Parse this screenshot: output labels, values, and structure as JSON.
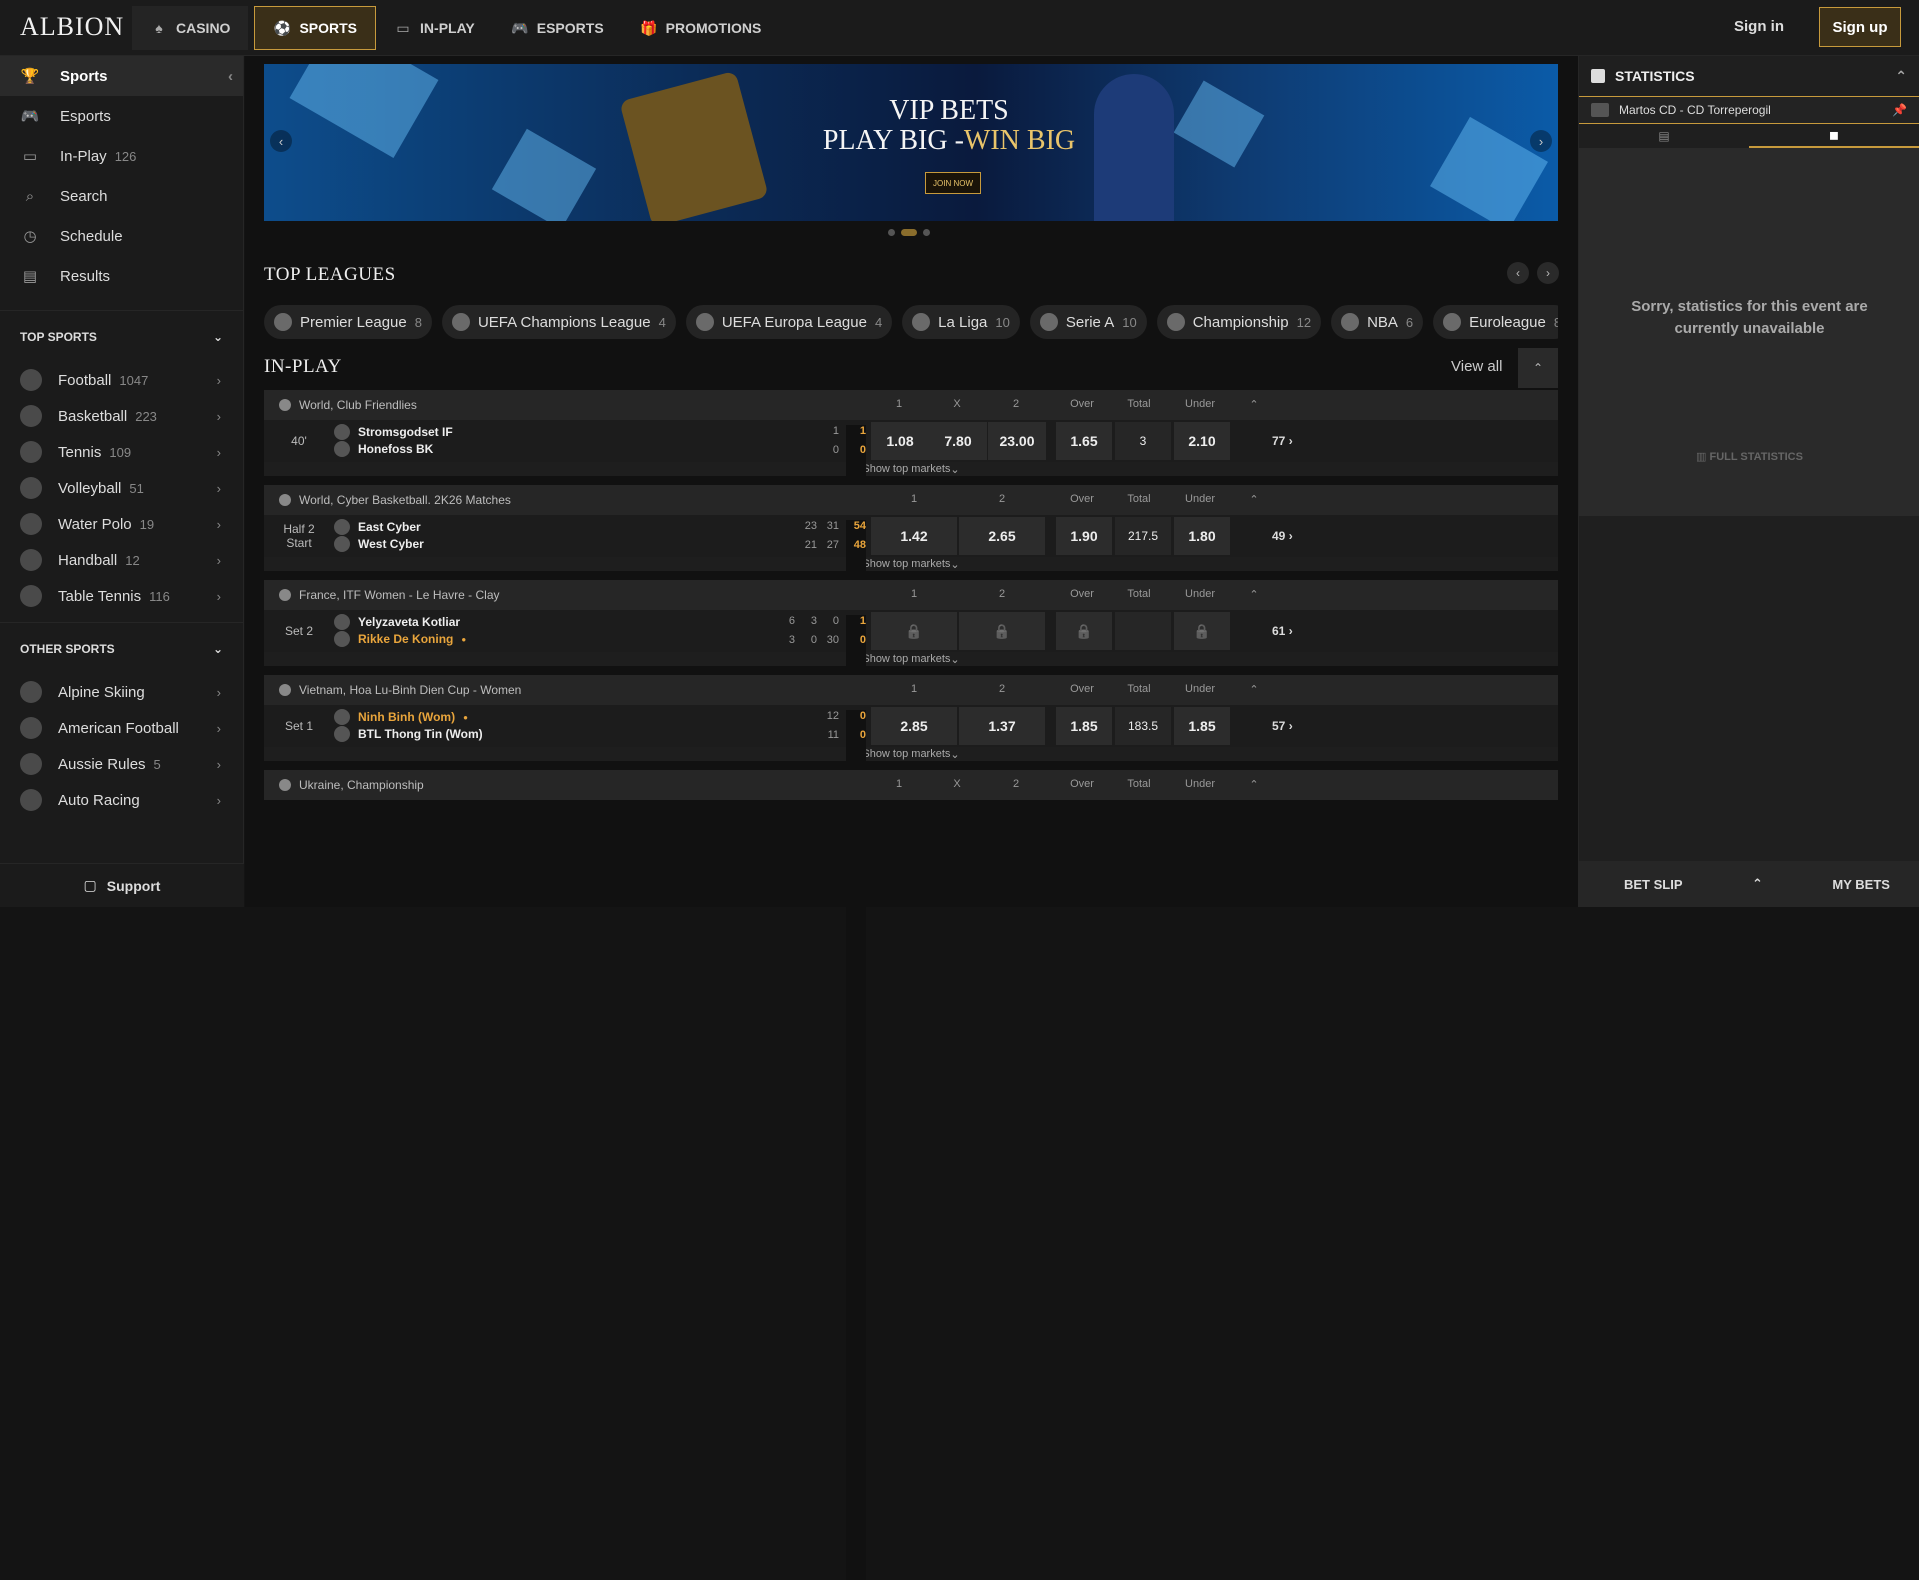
{
  "header": {
    "logo": "ALBION",
    "nav": [
      {
        "label": "CASINO",
        "icon": "spade-icon"
      },
      {
        "label": "SPORTS",
        "icon": "ball-icon",
        "active": true
      },
      {
        "label": "IN-PLAY",
        "icon": "live-icon"
      },
      {
        "label": "ESPORTS",
        "icon": "gamepad-icon"
      },
      {
        "label": "PROMOTIONS",
        "icon": "gift-icon"
      }
    ],
    "signin": "Sign in",
    "signup": "Sign up"
  },
  "sidebar": {
    "items": [
      {
        "label": "Sports",
        "icon": "trophy-icon",
        "active": true
      },
      {
        "label": "Esports",
        "icon": "gamepad-icon"
      },
      {
        "label": "In-Play",
        "count": "126",
        "icon": "live-icon"
      },
      {
        "label": "Search",
        "icon": "search-icon"
      },
      {
        "label": "Schedule",
        "icon": "clock-icon"
      },
      {
        "label": "Results",
        "icon": "clipboard-icon"
      }
    ],
    "top_sports_title": "TOP SPORTS",
    "top_sports": [
      {
        "label": "Football",
        "count": "1047"
      },
      {
        "label": "Basketball",
        "count": "223"
      },
      {
        "label": "Tennis",
        "count": "109"
      },
      {
        "label": "Volleyball",
        "count": "51"
      },
      {
        "label": "Water Polo",
        "count": "19"
      },
      {
        "label": "Handball",
        "count": "12"
      },
      {
        "label": "Table Tennis",
        "count": "116"
      }
    ],
    "other_sports_title": "OTHER SPORTS",
    "other_sports": [
      {
        "label": "Alpine Skiing",
        "count": ""
      },
      {
        "label": "American Football",
        "count": ""
      },
      {
        "label": "Aussie Rules",
        "count": "5"
      },
      {
        "label": "Auto Racing",
        "count": ""
      }
    ],
    "support": "Support"
  },
  "banner": {
    "line1": "VIP BETS",
    "line2a": "PLAY BIG -",
    "line2b": "WIN BIG",
    "cta": "JOIN NOW"
  },
  "top_leagues": {
    "title": "TOP LEAGUES",
    "items": [
      {
        "label": "Premier League",
        "count": "8"
      },
      {
        "label": "UEFA Champions League",
        "count": "4"
      },
      {
        "label": "UEFA Europa League",
        "count": "4"
      },
      {
        "label": "La Liga",
        "count": "10"
      },
      {
        "label": "Serie A",
        "count": "10"
      },
      {
        "label": "Championship",
        "count": "12"
      },
      {
        "label": "NBA",
        "count": "6"
      },
      {
        "label": "Euroleague",
        "count": "8"
      }
    ]
  },
  "inplay": {
    "title": "IN-PLAY",
    "view_all": "View all",
    "show_top": "Show top markets",
    "events": [
      {
        "league": "World, Club Friendlies",
        "cols": [
          "1",
          "X",
          "2",
          "Over",
          "Total",
          "Under"
        ],
        "time1": "40'",
        "time2": "",
        "home": "Stromsgodset IF",
        "away": "Honefoss BK",
        "hs": [
          "",
          "1"
        ],
        "as": [
          "",
          "0"
        ],
        "hmain": "1",
        "amain": "0",
        "odds": [
          "1.08",
          "7.80",
          "23.00"
        ],
        "ou": [
          "1.65",
          "3",
          "2.10"
        ],
        "more": "77"
      },
      {
        "league": "World, Cyber Basketball. 2K26 Matches",
        "cols": [
          "1",
          "2",
          "Over",
          "Total",
          "Under"
        ],
        "time1": "Half 2",
        "time2": "Start",
        "home": "East Cyber",
        "away": "West Cyber",
        "hs": [
          "23",
          "31"
        ],
        "as": [
          "21",
          "27"
        ],
        "hmain": "54",
        "amain": "48",
        "odds": [
          "1.42",
          "2.65"
        ],
        "ou": [
          "1.90",
          "217.5",
          "1.80"
        ],
        "more": "49"
      },
      {
        "league": "France, ITF Women - Le Havre - Clay",
        "cols": [
          "1",
          "2",
          "Over",
          "Total",
          "Under"
        ],
        "time1": "Set 2",
        "time2": "",
        "home": "Yelyzaveta Kotliar",
        "away": "Rikke De Koning",
        "hs": [
          "6",
          "3",
          "0"
        ],
        "as": [
          "3",
          "0",
          "30"
        ],
        "hmain": "1",
        "amain": "0",
        "odds": [
          "",
          "",
          ""
        ],
        "ou": [
          "",
          "",
          ""
        ],
        "more": "61"
      },
      {
        "league": "Vietnam, Hoa Lu-Binh Dien Cup - Women",
        "cols": [
          "1",
          "2",
          "Over",
          "Total",
          "Under"
        ],
        "time1": "Set 1",
        "time2": "",
        "home": "Ninh Binh (Wom)",
        "away": "BTL Thong Tin (Wom)",
        "hs": [
          "12"
        ],
        "as": [
          "11"
        ],
        "hmain": "0",
        "amain": "0",
        "odds": [
          "2.85",
          "1.37"
        ],
        "ou": [
          "1.85",
          "183.5",
          "1.85"
        ],
        "more": "57"
      },
      {
        "league": "Ukraine, Championship",
        "cols": [
          "1",
          "X",
          "2",
          "Over",
          "Total",
          "Under"
        ]
      }
    ]
  },
  "stats": {
    "title": "STATISTICS",
    "match": "Martos CD - CD Torreperogil",
    "sorry": "Sorry, statistics for this event are currently unavailable",
    "full": "FULL STATISTICS",
    "betslip": "BET SLIP",
    "mybets": "MY BETS"
  }
}
